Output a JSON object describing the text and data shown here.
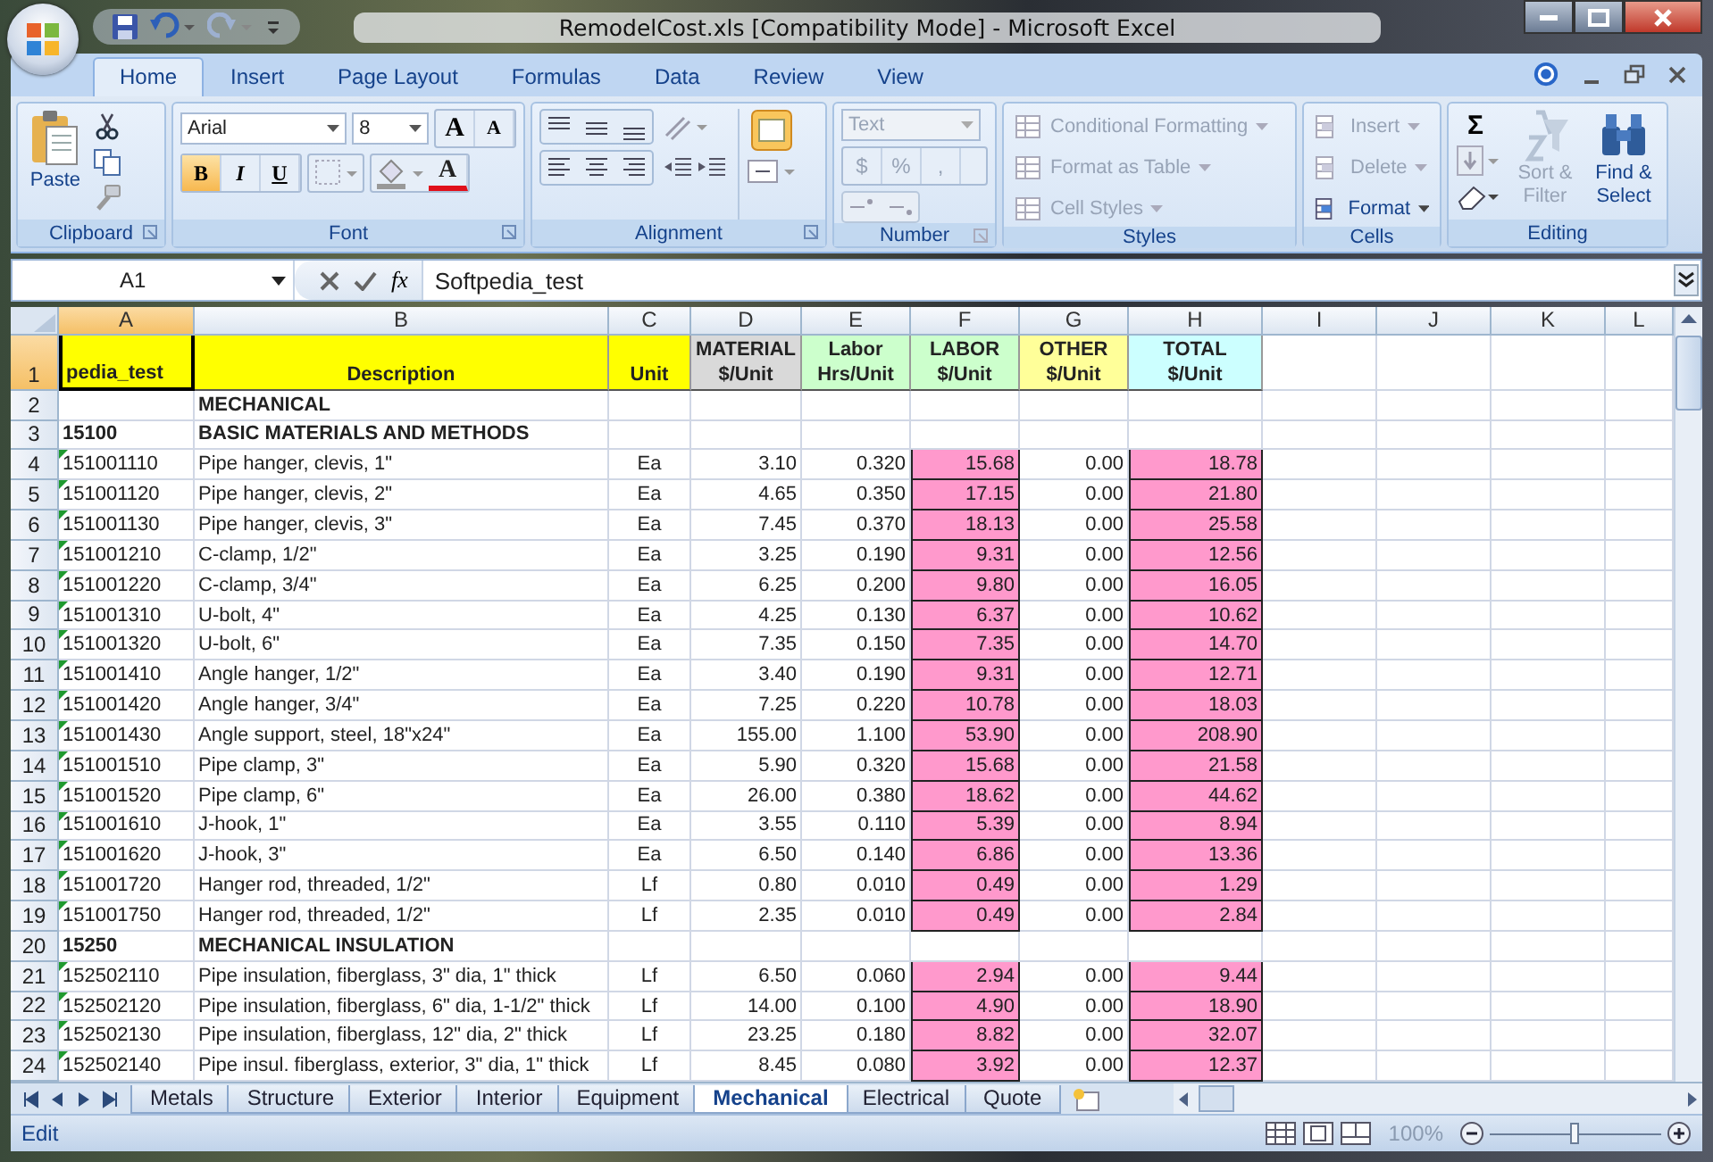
{
  "window": {
    "title": "RemodelCost.xls  [Compatibility Mode] - Microsoft Excel"
  },
  "ribbon_tabs": [
    {
      "label": "Home",
      "selected": true
    },
    {
      "label": "Insert",
      "selected": false
    },
    {
      "label": "Page Layout",
      "selected": false
    },
    {
      "label": "Formulas",
      "selected": false
    },
    {
      "label": "Data",
      "selected": false
    },
    {
      "label": "Review",
      "selected": false
    },
    {
      "label": "View",
      "selected": false
    }
  ],
  "ribbon": {
    "clipboard": {
      "label": "Clipboard",
      "paste": "Paste"
    },
    "font": {
      "label": "Font",
      "font_name": "Arial",
      "font_size": "8",
      "grow": "A",
      "shrink": "A",
      "bold": {
        "label": "B",
        "on": true
      },
      "italic": "I",
      "underline": "U",
      "font_color": "A"
    },
    "alignment": {
      "label": "Alignment"
    },
    "number": {
      "label": "Number",
      "format": "Text",
      "currency": "$",
      "percent": "%",
      "comma": ","
    },
    "styles": {
      "label": "Styles",
      "items": [
        {
          "label": "Conditional Formatting",
          "disabled": true
        },
        {
          "label": "Format as Table",
          "disabled": true
        },
        {
          "label": "Cell Styles",
          "disabled": true
        }
      ]
    },
    "cells": {
      "label": "Cells",
      "items": [
        {
          "label": "Insert",
          "disabled": true
        },
        {
          "label": "Delete",
          "disabled": true
        },
        {
          "label": "Format",
          "disabled": false
        }
      ]
    },
    "editing": {
      "label": "Editing",
      "autosum": "Σ",
      "sort": {
        "label": "Sort & Filter",
        "disabled": true
      },
      "find": {
        "label": "Find & Select",
        "disabled": false
      }
    }
  },
  "formula_bar": {
    "name_box": "A1",
    "function_label": "fx",
    "formula": "Softpedia_test"
  },
  "columns": [
    {
      "label": "A",
      "selected": true
    },
    {
      "label": "B",
      "selected": false
    },
    {
      "label": "C",
      "selected": false
    },
    {
      "label": "D",
      "selected": false
    },
    {
      "label": "E",
      "selected": false
    },
    {
      "label": "F",
      "selected": false
    },
    {
      "label": "G",
      "selected": false
    },
    {
      "label": "H",
      "selected": false
    },
    {
      "label": "I",
      "selected": false
    },
    {
      "label": "J",
      "selected": false
    },
    {
      "label": "K",
      "selected": false
    },
    {
      "label": "L",
      "selected": false
    }
  ],
  "header_row": {
    "num": "1",
    "selected": true,
    "cells": [
      {
        "lines": [
          "pedia_test"
        ],
        "color": "#ffff00"
      },
      {
        "lines": [
          "Description"
        ],
        "color": "#ffff00"
      },
      {
        "lines": [
          "Unit"
        ],
        "color": "#ffff00"
      },
      {
        "lines": [
          "MATERIAL",
          "$/Unit"
        ],
        "color": "#d9d9d9"
      },
      {
        "lines": [
          "Labor",
          "Hrs/Unit"
        ],
        "color": "#ccffcc"
      },
      {
        "lines": [
          "LABOR",
          "$/Unit"
        ],
        "color": "#ccffcc"
      },
      {
        "lines": [
          "OTHER",
          "$/Unit"
        ],
        "color": "#ffff99"
      },
      {
        "lines": [
          "TOTAL",
          "$/Unit"
        ],
        "color": "#ccffff"
      }
    ]
  },
  "rows": [
    {
      "num": "2",
      "kind": "section",
      "selected": false,
      "a": "",
      "b": "MECHANICAL"
    },
    {
      "num": "3",
      "kind": "section",
      "selected": false,
      "a": "15100",
      "b": "BASIC MATERIALS AND METHODS"
    },
    {
      "num": "4",
      "kind": "item",
      "selected": false,
      "a": "151001110",
      "b": "Pipe hanger, clevis, 1\"",
      "c": "Ea",
      "d": "3.10",
      "e": "0.320",
      "f": "15.68",
      "g": "0.00",
      "h": "18.78"
    },
    {
      "num": "5",
      "kind": "item",
      "selected": false,
      "a": "151001120",
      "b": "Pipe hanger, clevis, 2\"",
      "c": "Ea",
      "d": "4.65",
      "e": "0.350",
      "f": "17.15",
      "g": "0.00",
      "h": "21.80"
    },
    {
      "num": "6",
      "kind": "item",
      "selected": false,
      "a": "151001130",
      "b": "Pipe hanger, clevis, 3\"",
      "c": "Ea",
      "d": "7.45",
      "e": "0.370",
      "f": "18.13",
      "g": "0.00",
      "h": "25.58"
    },
    {
      "num": "7",
      "kind": "item",
      "selected": false,
      "a": "151001210",
      "b": "C-clamp, 1/2\"",
      "c": "Ea",
      "d": "3.25",
      "e": "0.190",
      "f": "9.31",
      "g": "0.00",
      "h": "12.56"
    },
    {
      "num": "8",
      "kind": "item",
      "selected": false,
      "a": "151001220",
      "b": "C-clamp, 3/4\"",
      "c": "Ea",
      "d": "6.25",
      "e": "0.200",
      "f": "9.80",
      "g": "0.00",
      "h": "16.05"
    },
    {
      "num": "9",
      "kind": "item",
      "selected": false,
      "a": "151001310",
      "b": "U-bolt, 4\"",
      "c": "Ea",
      "d": "4.25",
      "e": "0.130",
      "f": "6.37",
      "g": "0.00",
      "h": "10.62"
    },
    {
      "num": "10",
      "kind": "item",
      "selected": false,
      "a": "151001320",
      "b": "U-bolt, 6\"",
      "c": "Ea",
      "d": "7.35",
      "e": "0.150",
      "f": "7.35",
      "g": "0.00",
      "h": "14.70"
    },
    {
      "num": "11",
      "kind": "item",
      "selected": false,
      "a": "151001410",
      "b": "Angle hanger, 1/2\"",
      "c": "Ea",
      "d": "3.40",
      "e": "0.190",
      "f": "9.31",
      "g": "0.00",
      "h": "12.71"
    },
    {
      "num": "12",
      "kind": "item",
      "selected": false,
      "a": "151001420",
      "b": "Angle hanger, 3/4\"",
      "c": "Ea",
      "d": "7.25",
      "e": "0.220",
      "f": "10.78",
      "g": "0.00",
      "h": "18.03"
    },
    {
      "num": "13",
      "kind": "item",
      "selected": false,
      "a": "151001430",
      "b": "Angle support, steel, 18\"x24\"",
      "c": "Ea",
      "d": "155.00",
      "e": "1.100",
      "f": "53.90",
      "g": "0.00",
      "h": "208.90"
    },
    {
      "num": "14",
      "kind": "item",
      "selected": false,
      "a": "151001510",
      "b": "Pipe clamp, 3\"",
      "c": "Ea",
      "d": "5.90",
      "e": "0.320",
      "f": "15.68",
      "g": "0.00",
      "h": "21.58"
    },
    {
      "num": "15",
      "kind": "item",
      "selected": false,
      "a": "151001520",
      "b": "Pipe clamp, 6\"",
      "c": "Ea",
      "d": "26.00",
      "e": "0.380",
      "f": "18.62",
      "g": "0.00",
      "h": "44.62"
    },
    {
      "num": "16",
      "kind": "item",
      "selected": false,
      "a": "151001610",
      "b": "J-hook, 1\"",
      "c": "Ea",
      "d": "3.55",
      "e": "0.110",
      "f": "5.39",
      "g": "0.00",
      "h": "8.94"
    },
    {
      "num": "17",
      "kind": "item",
      "selected": false,
      "a": "151001620",
      "b": "J-hook, 3\"",
      "c": "Ea",
      "d": "6.50",
      "e": "0.140",
      "f": "6.86",
      "g": "0.00",
      "h": "13.36"
    },
    {
      "num": "18",
      "kind": "item",
      "selected": false,
      "a": "151001720",
      "b": "Hanger rod, threaded, 1/2\"",
      "c": "Lf",
      "d": "0.80",
      "e": "0.010",
      "f": "0.49",
      "g": "0.00",
      "h": "1.29"
    },
    {
      "num": "19",
      "kind": "item",
      "selected": false,
      "a": "151001750",
      "b": "Hanger rod, threaded, 1/2\"",
      "c": "Lf",
      "d": "2.35",
      "e": "0.010",
      "f": "0.49",
      "g": "0.00",
      "h": "2.84"
    },
    {
      "num": "20",
      "kind": "section",
      "selected": false,
      "a": "15250",
      "b": "MECHANICAL INSULATION"
    },
    {
      "num": "21",
      "kind": "item",
      "selected": false,
      "a": "152502110",
      "b": "Pipe insulation, fiberglass, 3\" dia, 1\" thick",
      "c": "Lf",
      "d": "6.50",
      "e": "0.060",
      "f": "2.94",
      "g": "0.00",
      "h": "9.44"
    },
    {
      "num": "22",
      "kind": "item",
      "selected": false,
      "a": "152502120",
      "b": "Pipe insulation, fiberglass, 6\" dia, 1-1/2\" thick",
      "c": "Lf",
      "d": "14.00",
      "e": "0.100",
      "f": "4.90",
      "g": "0.00",
      "h": "18.90"
    },
    {
      "num": "23",
      "kind": "item",
      "selected": false,
      "a": "152502130",
      "b": "Pipe insulation, fiberglass, 12\" dia, 2\" thick",
      "c": "Lf",
      "d": "23.25",
      "e": "0.180",
      "f": "8.82",
      "g": "0.00",
      "h": "32.07"
    },
    {
      "num": "24",
      "kind": "item",
      "selected": false,
      "a": "152502140",
      "b": "Pipe insul. fiberglass, exterior, 3\" dia, 1\" thick",
      "c": "Lf",
      "d": "8.45",
      "e": "0.080",
      "f": "3.92",
      "g": "0.00",
      "h": "12.37"
    }
  ],
  "sheet_tabs": [
    {
      "label": "Metals",
      "selected": false
    },
    {
      "label": "Structure",
      "selected": false
    },
    {
      "label": "Exterior",
      "selected": false
    },
    {
      "label": "Interior",
      "selected": false
    },
    {
      "label": "Equipment",
      "selected": false
    },
    {
      "label": "Mechanical",
      "selected": true
    },
    {
      "label": "Electrical",
      "selected": false
    },
    {
      "label": "Quote",
      "selected": false
    }
  ],
  "status_bar": {
    "mode": "Edit",
    "zoom": "100%",
    "zoom_slider": {
      "level": 0.5
    }
  }
}
